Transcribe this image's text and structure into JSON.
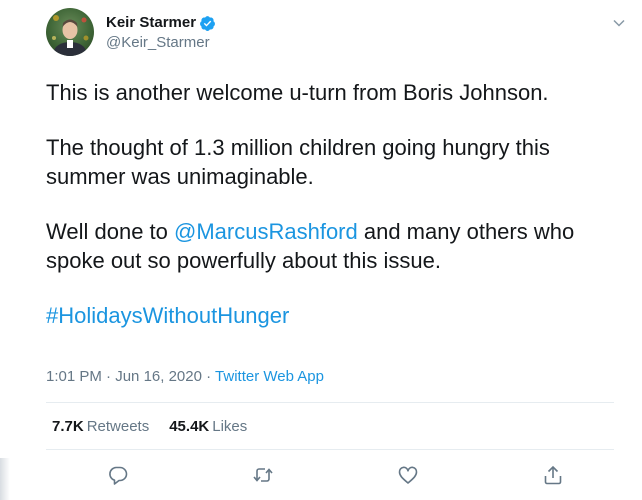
{
  "author": {
    "display_name": "Keir Starmer",
    "handle": "@Keir_Starmer",
    "verified_icon": "verified-badge-icon",
    "avatar_icon": "profile-photo"
  },
  "tweet": {
    "line1": "This is another welcome u-turn from Boris Johnson.",
    "line2": "The thought of 1.3 million children going hungry this summer was unimaginable.",
    "line3_prefix": "Well done to ",
    "mention": "@MarcusRashford",
    "line3_suffix": " and many others who spoke out so powerfully about this issue.",
    "hashtag": "#HolidaysWithoutHunger"
  },
  "meta": {
    "time": "1:01 PM",
    "date": "Jun 16, 2020",
    "separator": "·",
    "source": "Twitter Web App"
  },
  "stats": {
    "retweets_count": "7.7K",
    "retweets_label": "Retweets",
    "likes_count": "45.4K",
    "likes_label": "Likes"
  },
  "actions": {
    "reply_icon": "reply-icon",
    "retweet_icon": "retweet-icon",
    "like_icon": "like-icon",
    "share_icon": "share-icon",
    "more_icon": "chevron-down-icon"
  },
  "colors": {
    "link": "#1b95e0",
    "secondary_text": "#657786",
    "primary_text": "#14171a",
    "divider": "#e6ecf0",
    "verified": "#1da1f2"
  }
}
